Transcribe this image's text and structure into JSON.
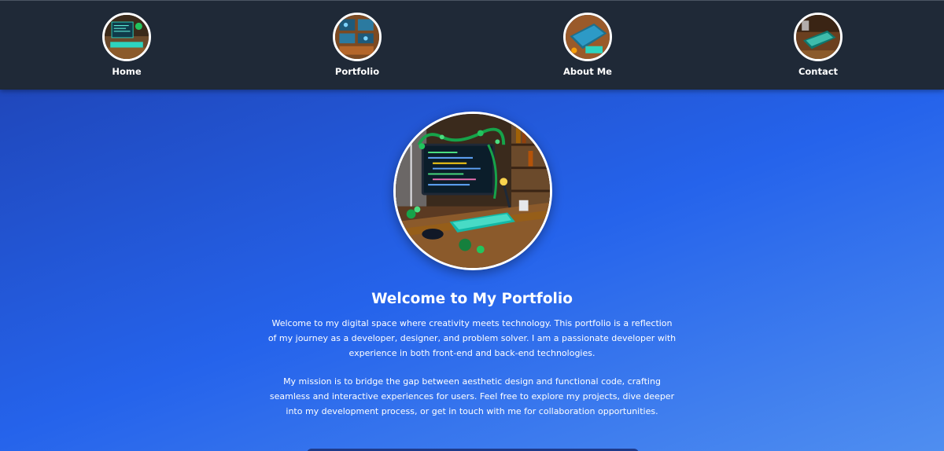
{
  "nav": {
    "items": [
      {
        "label": "Home",
        "icon": "workspace-thumbnail-icon"
      },
      {
        "label": "Portfolio",
        "icon": "bookshelf-thumbnail-icon"
      },
      {
        "label": "About Me",
        "icon": "desk-thumbnail-icon"
      },
      {
        "label": "Contact",
        "icon": "phone-desk-thumbnail-icon"
      }
    ]
  },
  "hero": {
    "image": "coding-workspace-illustration",
    "title": "Welcome to My Portfolio",
    "paragraphs": [
      "Welcome to my digital space where creativity meets technology. This portfolio is a reflection of my journey as a developer, designer, and problem solver. I am a passionate developer with experience in both front-end and back-end technologies.",
      "My mission is to bridge the gap between aesthetic design and functional code, crafting seamless and interactive experiences for users. Feel free to explore my projects, dive deeper into my development process, or get in touch with me for collaboration opportunities."
    ]
  },
  "colors": {
    "nav_background": "#1f2937",
    "page_gradient_start": "#1e40af",
    "page_gradient_end": "#4f8ef0",
    "text": "#ffffff"
  }
}
